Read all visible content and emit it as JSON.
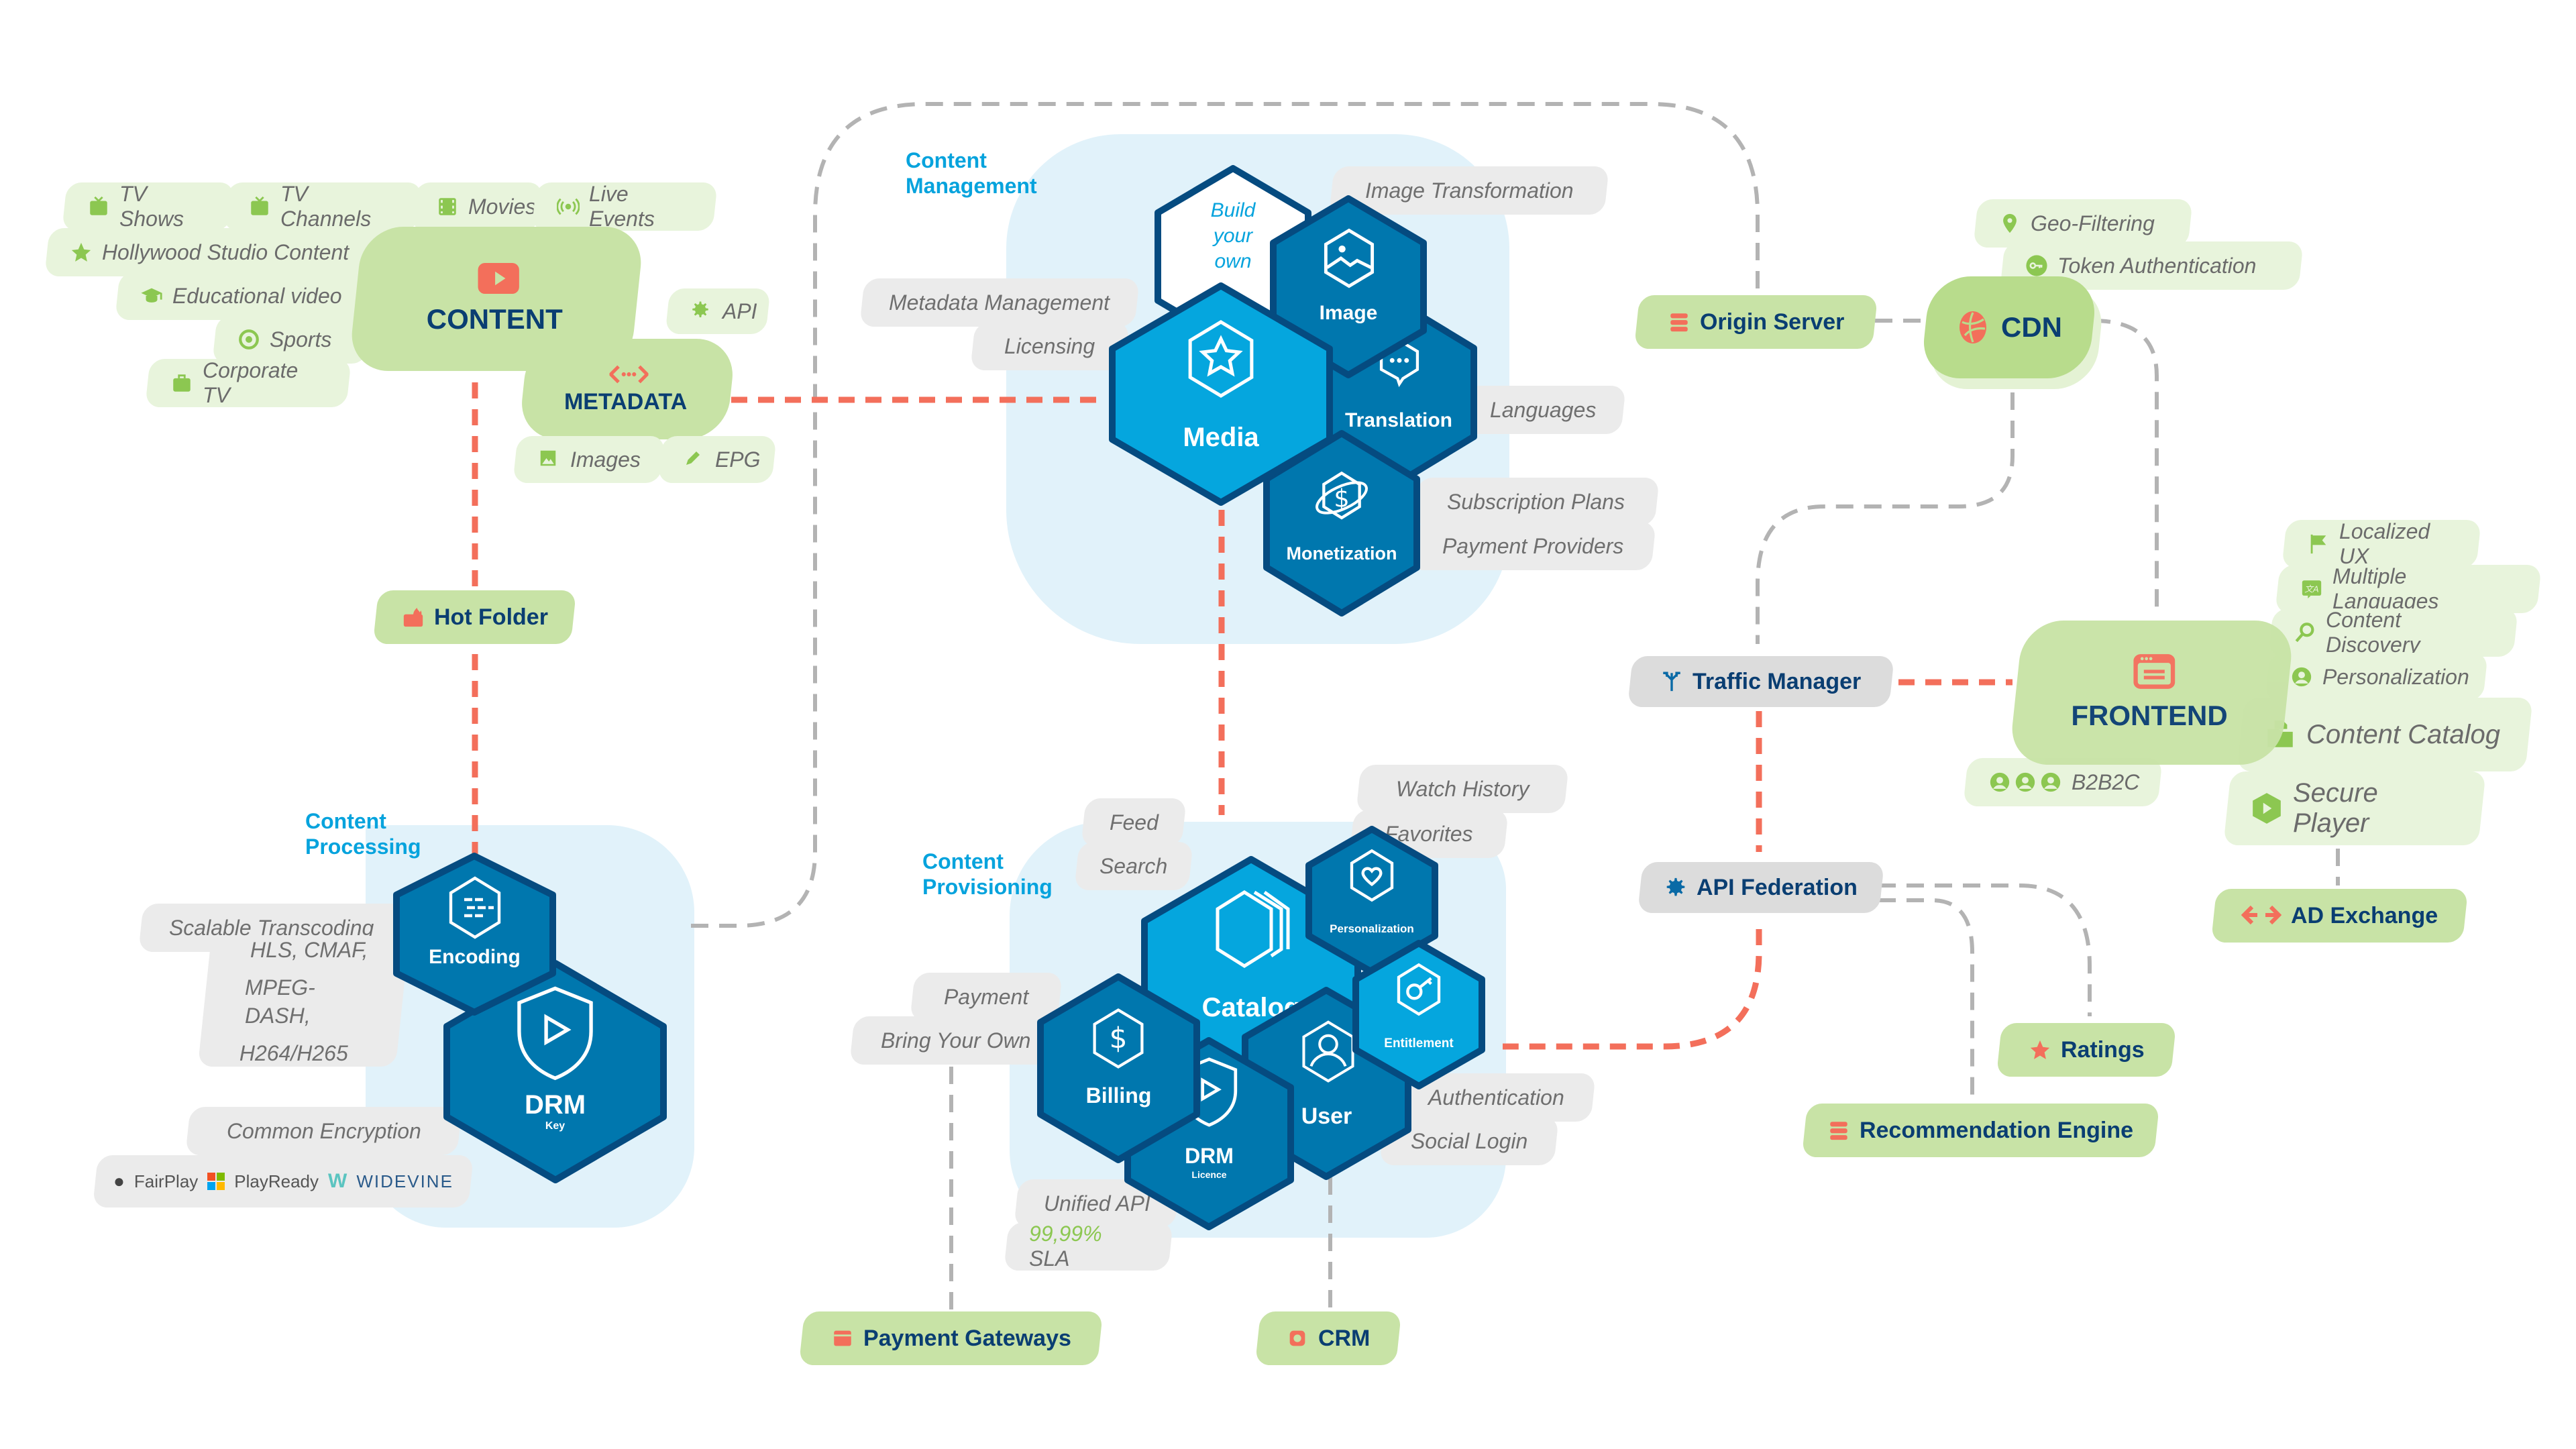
{
  "colors": {
    "green_node": "#c8e3a6",
    "green_light": "#e8f4dc",
    "grey_pill": "#ebebeb",
    "hex_light": "#05a6de",
    "hex_dark": "#0077ae",
    "hex_outline": "#054b80",
    "panel": "#e1f2fa",
    "coral": "#f36f5b",
    "navy_text": "#0a3e72",
    "section_title": "#06a3dd",
    "accent_green": "#8cc751"
  },
  "content": {
    "title": "CONTENT",
    "icon": "video-play-icon",
    "types": [
      {
        "label": "TV Shows",
        "icon": "tv-icon"
      },
      {
        "label": "TV Channels",
        "icon": "tv-icon"
      },
      {
        "label": "Movies",
        "icon": "film-icon"
      },
      {
        "label": "Live Events",
        "icon": "broadcast-icon"
      },
      {
        "label": "Hollywood Studio Content",
        "icon": "star-icon"
      },
      {
        "label": "Educational video",
        "icon": "graduation-cap-icon"
      },
      {
        "label": "Sports",
        "icon": "ball-icon"
      },
      {
        "label": "Corporate TV",
        "icon": "briefcase-icon"
      }
    ]
  },
  "metadata": {
    "title": "METADATA",
    "icon": "code-icon",
    "api": {
      "label": "API",
      "icon": "gear-icon"
    },
    "images": {
      "label": "Images",
      "icon": "image-icon"
    },
    "epg": {
      "label": "EPG",
      "icon": "pencil-icon"
    }
  },
  "hot_folder": {
    "label": "Hot Folder",
    "icon": "folder-fire-icon"
  },
  "content_management": {
    "title_line1": "Content",
    "title_line2": "Management",
    "build_your_own": [
      "Build",
      "your",
      "own"
    ],
    "media": "Media",
    "image": "Image",
    "translation": "Translation",
    "monetization": "Monetization",
    "features": {
      "metadata_management": "Metadata Management",
      "licensing": "Licensing",
      "image_transformation": "Image Transformation",
      "languages": "Languages",
      "subscription_plans": "Subscription Plans",
      "payment_providers": "Payment Providers"
    }
  },
  "content_processing": {
    "title_line1": "Content",
    "title_line2": "Processing",
    "encoding": "Encoding",
    "drm": "DRM",
    "drm_sub": "Key",
    "features": {
      "scalable_transcoding": "Scalable Transcoding",
      "formats": [
        "HLS, CMAF,",
        "MPEG-DASH,",
        "H264/H265"
      ],
      "common_encryption": "Common Encryption",
      "drm_vendors": [
        "FairPlay",
        "PlayReady",
        "WIDEVINE"
      ]
    }
  },
  "content_provisioning": {
    "title_line1": "Content",
    "title_line2": "Provisioning",
    "catalog": "Catalog",
    "personalization": "Personalization",
    "entitlement": "Entitlement",
    "billing": "Billing",
    "drm": "DRM",
    "drm_sub": "Licence",
    "user": "User",
    "features": {
      "feed": "Feed",
      "search": "Search",
      "watch_history": "Watch History",
      "favorites": "Favorites",
      "payment": "Payment",
      "bring_your_own": "Bring Your Own",
      "authentication": "Authentication",
      "social_login": "Social Login",
      "unified_api": "Unified API",
      "sla_value": "99,99%",
      "sla_label": "SLA"
    }
  },
  "delivery": {
    "origin_server": {
      "label": "Origin Server",
      "icon": "server-icon"
    },
    "cdn": {
      "label": "CDN",
      "icon": "globe-icon"
    },
    "geo_filtering": {
      "label": "Geo-Filtering",
      "icon": "location-pin-icon"
    },
    "token_authentication": {
      "label": "Token Authentication",
      "icon": "key-icon"
    },
    "traffic_manager": {
      "label": "Traffic Manager",
      "icon": "split-arrows-icon"
    },
    "api_federation": {
      "label": "API Federation",
      "icon": "gear-icon"
    },
    "ratings": {
      "label": "Ratings",
      "icon": "star-icon"
    },
    "recommendation_engine": {
      "label": "Recommendation Engine",
      "icon": "server-icon"
    },
    "payment_gateways": {
      "label": "Payment Gateways",
      "icon": "card-icon"
    },
    "crm": {
      "label": "CRM",
      "icon": "crm-icon"
    }
  },
  "frontend": {
    "title": "FRONTEND",
    "icon": "browser-window-icon",
    "b2b2c": "B2B2C",
    "features": [
      {
        "label": "Localized UX",
        "icon": "flag-icon"
      },
      {
        "label": "Multiple Languages",
        "icon": "translate-icon"
      },
      {
        "label": "Content Discovery",
        "icon": "search-icon"
      },
      {
        "label": "Personalization",
        "icon": "user-icon"
      },
      {
        "label": "Content Catalog",
        "icon": "folders-icon"
      },
      {
        "label": "Secure Player",
        "icon": "play-hex-icon"
      }
    ],
    "ad_exchange": {
      "label": "AD Exchange",
      "icon": "exchange-arrows-icon"
    }
  }
}
